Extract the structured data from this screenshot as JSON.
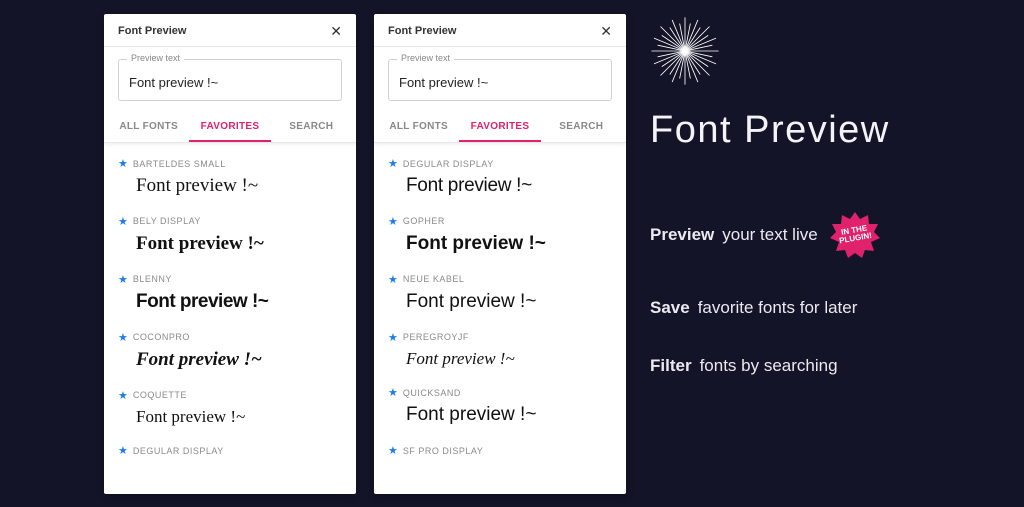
{
  "panel": {
    "title": "Font Preview",
    "close": "✕",
    "fieldLabel": "Preview text",
    "fieldValue": "Font preview !~",
    "tabs": [
      "ALL FONTS",
      "FAVORITES",
      "SEARCH"
    ],
    "activeTabIndex": 1
  },
  "leftFonts": [
    {
      "name": "BARTELDES SMALL",
      "sample": "Font preview !~",
      "styleClass": "s-barteldes"
    },
    {
      "name": "BELY DISPLAY",
      "sample": "Font preview !~",
      "styleClass": "s-bely"
    },
    {
      "name": "BLENNY",
      "sample": "Font preview !~",
      "styleClass": "s-blenny"
    },
    {
      "name": "COCONPRO",
      "sample": "Font preview !~",
      "styleClass": "s-cocon"
    },
    {
      "name": "COQUETTE",
      "sample": "Font preview !~",
      "styleClass": "s-coquette"
    },
    {
      "name": "DEGULAR DISPLAY",
      "sample": "",
      "styleClass": "s-degular"
    }
  ],
  "rightFonts": [
    {
      "name": "DEGULAR DISPLAY",
      "sample": "Font preview !~",
      "styleClass": "s-degular"
    },
    {
      "name": "GOPHER",
      "sample": "Font preview !~",
      "styleClass": "s-gopher"
    },
    {
      "name": "NEUE KABEL",
      "sample": "Font preview !~",
      "styleClass": "s-neuekabel"
    },
    {
      "name": "PEREGROYJF",
      "sample": "Font preview !~",
      "styleClass": "s-peregroy"
    },
    {
      "name": "QUICKSAND",
      "sample": "Font preview !~",
      "styleClass": "s-quicksand"
    },
    {
      "name": "SF PRO DISPLAY",
      "sample": "",
      "styleClass": ""
    }
  ],
  "marketing": {
    "headline": "Font Preview",
    "features": [
      {
        "bold": "Preview",
        "rest": "your text live",
        "badge": true
      },
      {
        "bold": "Save",
        "rest": "favorite fonts for later",
        "badge": false
      },
      {
        "bold": "Filter",
        "rest": "fonts by searching",
        "badge": false
      }
    ],
    "badgeLine1": "IN THE",
    "badgeLine2": "PLUGIN!"
  },
  "colors": {
    "accent": "#e0216b",
    "star": "#1e7ee6",
    "bg": "#131428"
  }
}
